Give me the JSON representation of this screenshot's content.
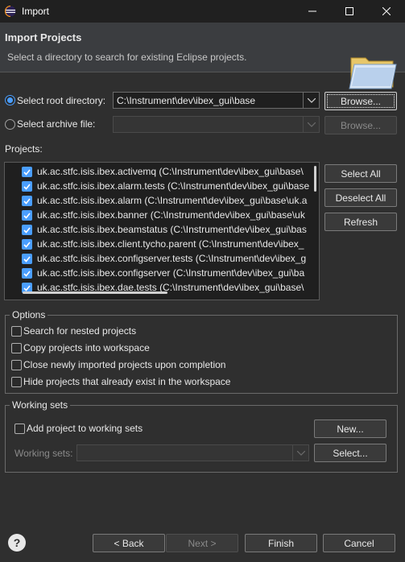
{
  "window": {
    "title": "Import",
    "controls": [
      "minimize",
      "maximize",
      "close"
    ]
  },
  "header": {
    "title": "Import Projects",
    "description": "Select a directory to search for existing Eclipse projects."
  },
  "source": {
    "root_directory_label": "Select root directory:",
    "root_directory_value": "C:\\Instrument\\dev\\ibex_gui\\base",
    "archive_file_label": "Select archive file:",
    "archive_file_value": "",
    "browse_label": "Browse...",
    "selected": "root_directory"
  },
  "projects": {
    "label": "Projects:",
    "items": [
      {
        "name": "uk.ac.stfc.isis.ibex.activemq (C:\\Instrument\\dev\\ibex_gui\\base\\",
        "checked": true
      },
      {
        "name": "uk.ac.stfc.isis.ibex.alarm.tests (C:\\Instrument\\dev\\ibex_gui\\base",
        "checked": true
      },
      {
        "name": "uk.ac.stfc.isis.ibex.alarm (C:\\Instrument\\dev\\ibex_gui\\base\\uk.a",
        "checked": true
      },
      {
        "name": "uk.ac.stfc.isis.ibex.banner (C:\\Instrument\\dev\\ibex_gui\\base\\uk",
        "checked": true
      },
      {
        "name": "uk.ac.stfc.isis.ibex.beamstatus (C:\\Instrument\\dev\\ibex_gui\\bas",
        "checked": true
      },
      {
        "name": "uk.ac.stfc.isis.ibex.client.tycho.parent (C:\\Instrument\\dev\\ibex_",
        "checked": true
      },
      {
        "name": "uk.ac.stfc.isis.ibex.configserver.tests (C:\\Instrument\\dev\\ibex_g",
        "checked": true
      },
      {
        "name": "uk.ac.stfc.isis.ibex.configserver (C:\\Instrument\\dev\\ibex_gui\\ba",
        "checked": true
      },
      {
        "name": "uk.ac.stfc.isis.ibex.dae.tests (C:\\Instrument\\dev\\ibex_gui\\base\\",
        "checked": true
      }
    ],
    "select_all_label": "Select All",
    "deselect_all_label": "Deselect All",
    "refresh_label": "Refresh"
  },
  "options": {
    "title": "Options",
    "items": [
      {
        "label": "Search for nested projects",
        "checked": false
      },
      {
        "label": "Copy projects into workspace",
        "checked": false
      },
      {
        "label": "Close newly imported projects upon completion",
        "checked": false
      },
      {
        "label": "Hide projects that already exist in the workspace",
        "checked": false
      }
    ]
  },
  "working_sets": {
    "title": "Working sets",
    "add_label": "Add project to working sets",
    "add_checked": false,
    "new_label": "New...",
    "sets_label": "Working sets:",
    "sets_value": "",
    "select_label": "Select..."
  },
  "footer": {
    "help_icon": "?",
    "back_label": "< Back",
    "next_label": "Next >",
    "finish_label": "Finish",
    "cancel_label": "Cancel"
  },
  "colors": {
    "accent": "#4a9eff",
    "background": "#2f2f2f",
    "titlebar": "#202020",
    "header": "#3b3d40",
    "list_bg": "#1f1f1f"
  }
}
